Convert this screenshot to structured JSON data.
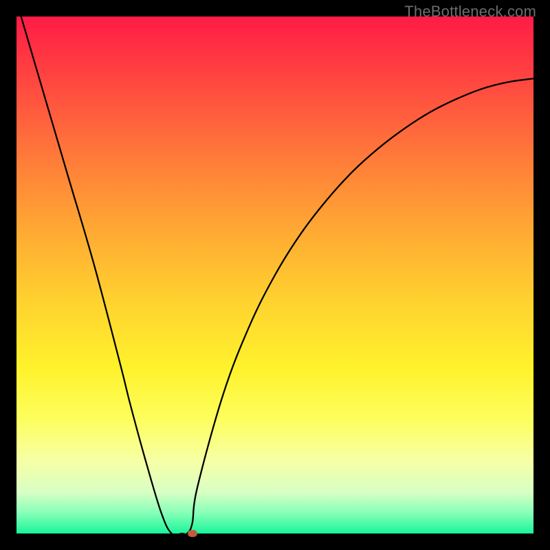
{
  "watermark": "TheBottleneck.com",
  "chart_data": {
    "type": "line",
    "title": "",
    "xlabel": "",
    "ylabel": "",
    "ylim": [
      0,
      100
    ],
    "xlim": [
      0,
      100
    ],
    "x": [
      0,
      5,
      10,
      15,
      20,
      22,
      25,
      28,
      30,
      32,
      33,
      34,
      35,
      40,
      45,
      50,
      55,
      60,
      65,
      70,
      75,
      80,
      85,
      90,
      95,
      100
    ],
    "values": [
      103,
      86,
      69,
      52,
      33,
      25,
      14,
      4,
      0,
      0,
      0,
      2,
      9,
      27,
      40,
      50,
      58,
      64.5,
      70,
      74.5,
      78.3,
      81.5,
      84,
      86,
      87.3,
      88
    ],
    "flat_segment_x": [
      30,
      34
    ],
    "marker": {
      "x": 34,
      "y": 0,
      "color": "#c25a3f"
    },
    "gradient_stops": [
      {
        "pct": 0,
        "color": "#ff1b46"
      },
      {
        "pct": 7,
        "color": "#ff3442"
      },
      {
        "pct": 18,
        "color": "#ff5a3e"
      },
      {
        "pct": 30,
        "color": "#ff8438"
      },
      {
        "pct": 42,
        "color": "#ffab33"
      },
      {
        "pct": 55,
        "color": "#ffd22f"
      },
      {
        "pct": 68,
        "color": "#fff22c"
      },
      {
        "pct": 78,
        "color": "#fdff5e"
      },
      {
        "pct": 86,
        "color": "#f6ffa6"
      },
      {
        "pct": 92,
        "color": "#d8ffc4"
      },
      {
        "pct": 96,
        "color": "#87ffb8"
      },
      {
        "pct": 100,
        "color": "#18f59a"
      }
    ]
  }
}
